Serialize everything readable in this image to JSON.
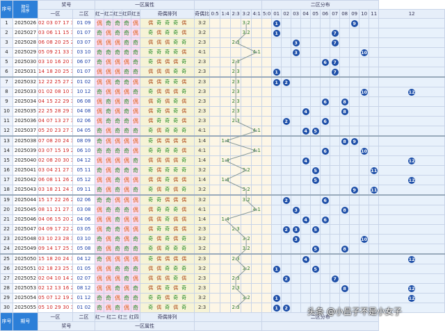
{
  "header": {
    "index": "序号",
    "period": "期号",
    "sort": "排序",
    "numbers": "奖号",
    "zone1": "一区",
    "zone2": "二区",
    "zone1_attr": "一区属性",
    "red_cols": [
      "红一",
      "红二",
      "红三",
      "红四",
      "红五"
    ],
    "oe_arrangement": "奇偶排列",
    "oe_ratio": "奇偶比",
    "ratios": [
      "0:5",
      "1:4",
      "2:3",
      "3:2",
      "4:1",
      "5:0"
    ],
    "zone2_dist": "二区分布",
    "zone2_nums": [
      "01",
      "02",
      "03",
      "04",
      "05",
      "06",
      "07",
      "08",
      "09",
      "10",
      "11",
      "12"
    ]
  },
  "rows": [
    {
      "i": "1",
      "p": "2025026",
      "z1": "02 03 07 17 30",
      "z2": "01 09",
      "r": [
        "偶",
        "奇",
        "奇",
        "奇",
        "偶"
      ],
      "oe": [
        "偶",
        "奇",
        "奇",
        "奇",
        "偶"
      ],
      "ratio": "3:2",
      "b": [
        1,
        9
      ]
    },
    {
      "i": "2",
      "p": "2025027",
      "z1": "03 06 11 15 30",
      "z2": "01 07",
      "r": [
        "奇",
        "偶",
        "奇",
        "奇",
        "偶"
      ],
      "oe": [
        "奇",
        "偶",
        "奇",
        "奇",
        "偶"
      ],
      "ratio": "3:2",
      "b": [
        1,
        7
      ]
    },
    {
      "i": "3",
      "p": "2025028",
      "z1": "06 08 20 25 29",
      "z2": "03 07",
      "r": [
        "偶",
        "偶",
        "偶",
        "奇",
        "奇"
      ],
      "oe": [
        "偶",
        "偶",
        "偶",
        "奇",
        "奇"
      ],
      "ratio": "2:3",
      "b": [
        3,
        7
      ]
    },
    {
      "i": "4",
      "p": "2025029",
      "z1": "05 09 21 33 33",
      "z2": "03 10",
      "r": [
        "奇",
        "奇",
        "奇",
        "奇",
        "奇"
      ],
      "oe": [
        "奇",
        "奇",
        "奇",
        "奇",
        "偶"
      ],
      "ratio": "4:1",
      "b": [
        3,
        10
      ]
    },
    {
      "i": "5",
      "p": "2025030",
      "z1": "03 10 16 20 31",
      "z2": "06 07",
      "r": [
        "奇",
        "偶",
        "偶",
        "偶",
        "奇"
      ],
      "oe": [
        "奇",
        "偶",
        "偶",
        "偶",
        "奇"
      ],
      "ratio": "2:3",
      "b": [
        6,
        7
      ]
    },
    {
      "i": "6",
      "p": "2025031",
      "z1": "14 18 20 25 35",
      "z2": "01 07",
      "r": [
        "偶",
        "偶",
        "偶",
        "奇",
        "奇"
      ],
      "oe": [
        "偶",
        "偶",
        "偶",
        "奇",
        "奇"
      ],
      "ratio": "2:3",
      "b": [
        1,
        7
      ]
    },
    {
      "i": "7",
      "p": "2025032",
      "z1": "12 22 25 27 28",
      "z2": "01 02",
      "r": [
        "偶",
        "偶",
        "奇",
        "奇",
        "偶"
      ],
      "oe": [
        "偶",
        "偶",
        "奇",
        "奇",
        "偶"
      ],
      "ratio": "2:3",
      "b": [
        1,
        2
      ]
    },
    {
      "i": "8",
      "p": "2025033",
      "z1": "01 02 08 10 33",
      "z2": "10 12",
      "r": [
        "奇",
        "偶",
        "偶",
        "偶",
        "奇"
      ],
      "oe": [
        "奇",
        "偶",
        "偶",
        "偶",
        "奇"
      ],
      "ratio": "2:3",
      "b": [
        10,
        12
      ]
    },
    {
      "i": "9",
      "p": "2025034",
      "z1": "04 15 22 29 34",
      "z2": "06 08",
      "r": [
        "偶",
        "奇",
        "偶",
        "奇",
        "偶"
      ],
      "oe": [
        "偶",
        "奇",
        "偶",
        "奇",
        "偶"
      ],
      "ratio": "2:3",
      "b": [
        6,
        8
      ]
    },
    {
      "i": "10",
      "p": "2025035",
      "z1": "22 25 28 29 30",
      "z2": "04 08",
      "r": [
        "偶",
        "奇",
        "偶",
        "奇",
        "偶"
      ],
      "oe": [
        "偶",
        "奇",
        "偶",
        "奇",
        "偶"
      ],
      "ratio": "2:3",
      "b": [
        4,
        8
      ]
    },
    {
      "i": "11",
      "p": "2025036",
      "z1": "04 07 13 27 30",
      "z2": "02 06",
      "r": [
        "偶",
        "奇",
        "奇",
        "奇",
        "偶"
      ],
      "oe": [
        "偶",
        "奇",
        "奇",
        "奇",
        "偶"
      ],
      "ratio": "2:3",
      "b": [
        2,
        6
      ]
    },
    {
      "i": "12",
      "p": "2025037",
      "z1": "05 20 23 27 31",
      "z2": "04 05",
      "r": [
        "奇",
        "偶",
        "奇",
        "奇",
        "奇"
      ],
      "oe": [
        "奇",
        "偶",
        "奇",
        "奇",
        "奇"
      ],
      "ratio": "4:1",
      "b": [
        4,
        5
      ]
    },
    {
      "i": "13",
      "p": "2025038",
      "z1": "07 08 20 24 34",
      "z2": "08 09",
      "r": [
        "奇",
        "偶",
        "偶",
        "偶",
        "偶"
      ],
      "oe": [
        "奇",
        "偶",
        "偶",
        "偶",
        "偶"
      ],
      "ratio": "1:4",
      "b": [
        8,
        9
      ]
    },
    {
      "i": "14",
      "p": "2025039",
      "z1": "03 07 15 19 20",
      "z2": "06 10",
      "r": [
        "奇",
        "奇",
        "奇",
        "奇",
        "偶"
      ],
      "oe": [
        "奇",
        "奇",
        "奇",
        "奇",
        "偶"
      ],
      "ratio": "4:1",
      "b": [
        6,
        10
      ]
    },
    {
      "i": "15",
      "p": "2025040",
      "z1": "02 08 20 30 33",
      "z2": "04 12",
      "r": [
        "偶",
        "偶",
        "偶",
        "偶",
        "奇"
      ],
      "oe": [
        "偶",
        "偶",
        "偶",
        "偶",
        "奇"
      ],
      "ratio": "1:4",
      "b": [
        4,
        12
      ]
    },
    {
      "i": "16",
      "p": "2025041",
      "z1": "03 04 21 27 35",
      "z2": "05 11",
      "r": [
        "奇",
        "偶",
        "奇",
        "奇",
        "奇"
      ],
      "oe": [
        "奇",
        "偶",
        "奇",
        "奇",
        "奇"
      ],
      "ratio": "3:2",
      "b": [
        5,
        11
      ]
    },
    {
      "i": "17",
      "p": "2025042",
      "z1": "06 08 11 26 28",
      "z2": "05 12",
      "r": [
        "偶",
        "偶",
        "奇",
        "偶",
        "偶"
      ],
      "oe": [
        "偶",
        "偶",
        "奇",
        "偶",
        "偶"
      ],
      "ratio": "1:4",
      "b": [
        5,
        12
      ]
    },
    {
      "i": "18",
      "p": "2025043",
      "z1": "03 18 21 24 33",
      "z2": "09 11",
      "r": [
        "奇",
        "偶",
        "奇",
        "偶",
        "奇"
      ],
      "oe": [
        "奇",
        "偶",
        "奇",
        "偶",
        "奇"
      ],
      "ratio": "3:2",
      "b": [
        9,
        11
      ]
    },
    {
      "i": "19",
      "p": "2025044",
      "z1": "15 17 22 26 26",
      "z2": "02 06",
      "r": [
        "奇",
        "奇",
        "偶",
        "偶",
        "偶"
      ],
      "oe": [
        "奇",
        "奇",
        "偶",
        "偶",
        "偶"
      ],
      "ratio": "3:2",
      "b": [
        2,
        6
      ]
    },
    {
      "i": "20",
      "p": "2025045",
      "z1": "08 11 21 27 32",
      "z2": "03 08",
      "r": [
        "偶",
        "奇",
        "奇",
        "奇",
        "偶"
      ],
      "oe": [
        "偶",
        "奇",
        "奇",
        "奇",
        "偶"
      ],
      "ratio": "4:1",
      "b": [
        3,
        8
      ]
    },
    {
      "i": "21",
      "p": "2025046",
      "z1": "04 06 15 20 28",
      "z2": "04 06",
      "r": [
        "偶",
        "偶",
        "奇",
        "偶",
        "偶"
      ],
      "oe": [
        "偶",
        "偶",
        "奇",
        "偶",
        "偶"
      ],
      "ratio": "1:4",
      "b": [
        4,
        6
      ]
    },
    {
      "i": "22",
      "p": "2025047",
      "z1": "04 09 17 22 26",
      "z2": "03 05",
      "r": [
        "偶",
        "奇",
        "奇",
        "偶",
        "偶"
      ],
      "oe": [
        "偶",
        "奇",
        "奇",
        "偶",
        "偶"
      ],
      "ratio": "2:3",
      "b": [
        2,
        3,
        5
      ]
    },
    {
      "i": "23",
      "p": "2025048",
      "z1": "03 10 23 28 35",
      "z2": "03 10",
      "r": [
        "奇",
        "偶",
        "奇",
        "偶",
        "奇"
      ],
      "oe": [
        "奇",
        "偶",
        "奇",
        "偶",
        "奇"
      ],
      "ratio": "3:2",
      "b": [
        3,
        10
      ]
    },
    {
      "i": "24",
      "p": "2025049",
      "z1": "09 14 17 25 35",
      "z2": "05 08",
      "r": [
        "奇",
        "偶",
        "奇",
        "奇",
        "奇"
      ],
      "oe": [
        "奇",
        "偶",
        "奇",
        "奇",
        "奇"
      ],
      "ratio": "3:2",
      "b": [
        5,
        8
      ]
    },
    {
      "i": "25",
      "p": "2025050",
      "z1": "15 18 20 24 34",
      "z2": "04 12",
      "r": [
        "奇",
        "偶",
        "偶",
        "偶",
        "偶"
      ],
      "oe": [
        "奇",
        "偶",
        "偶",
        "偶",
        "偶"
      ],
      "ratio": "2:3",
      "b": [
        4,
        12
      ]
    },
    {
      "i": "26",
      "p": "2025051",
      "z1": "02 18 23 25 35",
      "z2": "01 05",
      "r": [
        "偶",
        "偶",
        "奇",
        "奇",
        "奇"
      ],
      "oe": [
        "偶",
        "偶",
        "奇",
        "奇",
        "奇"
      ],
      "ratio": "3:2",
      "b": [
        1,
        5
      ]
    },
    {
      "i": "27",
      "p": "2025052",
      "z1": "02 04 10 14 28",
      "z2": "02 07",
      "r": [
        "偶",
        "偶",
        "偶",
        "奇",
        "偶"
      ],
      "oe": [
        "偶",
        "偶",
        "偶",
        "奇",
        "偶"
      ],
      "ratio": "2:3",
      "b": [
        2,
        7
      ]
    },
    {
      "i": "28",
      "p": "2025053",
      "z1": "02 12 13 16 23",
      "z2": "08 12",
      "r": [
        "偶",
        "偶",
        "奇",
        "偶",
        "奇"
      ],
      "oe": [
        "偶",
        "偶",
        "奇",
        "偶",
        "奇"
      ],
      "ratio": "2:3",
      "b": [
        8,
        12
      ]
    },
    {
      "i": "29",
      "p": "2025054",
      "z1": "05 07 12 19 21",
      "z2": "01 12",
      "r": [
        "奇",
        "奇",
        "偶",
        "奇",
        "奇"
      ],
      "oe": [
        "奇",
        "奇",
        "偶",
        "奇",
        "奇"
      ],
      "ratio": "3:2",
      "b": [
        1,
        12
      ]
    },
    {
      "i": "30",
      "p": "2025055",
      "z1": "05 10 29 30 33",
      "z2": "01 02",
      "r": [
        "奇",
        "偶",
        "奇",
        "偶",
        "奇"
      ],
      "oe": [
        "奇",
        "偶",
        "奇",
        "偶",
        "奇"
      ],
      "ratio": "2:3",
      "b": [
        1,
        2
      ]
    }
  ],
  "watermark": "头条 @小吕子不是小女子",
  "colors": {
    "accent": "#2c7fd8",
    "ball": "#1e4fa8",
    "attr_bg": "#f9dcf0",
    "ratio_bg": "#f6f3d6"
  }
}
